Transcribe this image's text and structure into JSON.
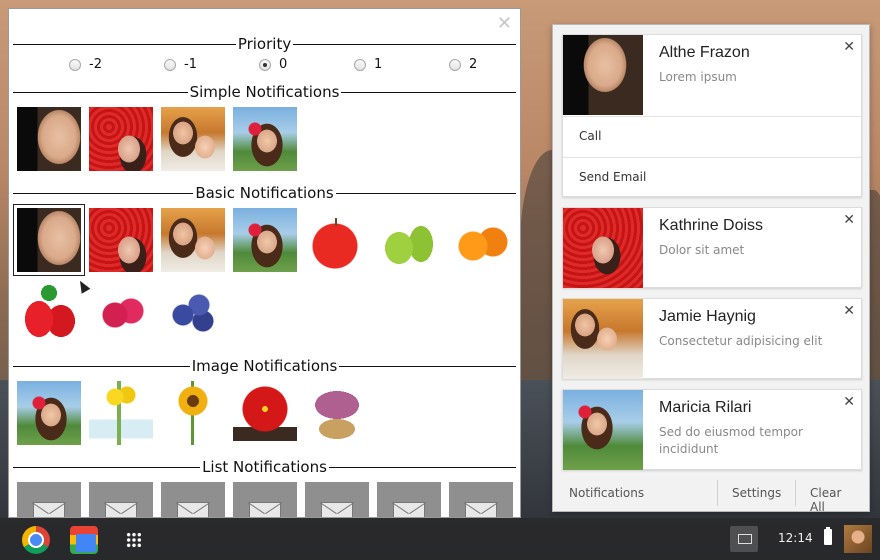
{
  "app": {
    "close_glyph": "✕",
    "sections": {
      "priority": "Priority",
      "simple": "Simple Notifications",
      "basic": "Basic Notifications",
      "image": "Image Notifications",
      "list": "List Notifications"
    },
    "priority_options": [
      {
        "label": "-2",
        "checked": false
      },
      {
        "label": "-1",
        "checked": false
      },
      {
        "label": "0",
        "checked": true
      },
      {
        "label": "1",
        "checked": false
      },
      {
        "label": "2",
        "checked": false
      }
    ],
    "simple_thumbs": [
      "man-portrait",
      "woman-red-umbrella",
      "mother-and-baby",
      "woman-with-flower"
    ],
    "basic_thumbs": [
      "man-portrait",
      "woman-red-umbrella",
      "mother-and-baby",
      "woman-with-flower",
      "apple",
      "pears",
      "oranges",
      "strawberries",
      "raspberries",
      "blueberries"
    ],
    "image_thumbs": [
      "woman-with-flower",
      "yellow-flowers",
      "sunflower",
      "poinsettia",
      "heather-basket"
    ],
    "list_thumb_count": 7
  },
  "notifications": [
    {
      "title": "Althe Frazon",
      "body": "Lorem ipsum",
      "close": "✕",
      "buttons": [
        "Call",
        "Send Email"
      ]
    },
    {
      "title": "Kathrine Doiss",
      "body": "Dolor sit amet",
      "close": "✕"
    },
    {
      "title": "Jamie Haynig",
      "body": "Consectetur adipisicing elit",
      "close": "✕"
    },
    {
      "title": "Maricia Rilari",
      "body": "Sed do eiusmod tempor incididunt",
      "close": "✕"
    }
  ],
  "panel_footer": {
    "label": "Notifications",
    "settings": "Settings",
    "clear_all": "Clear All"
  },
  "shelf": {
    "clock": "12:14"
  }
}
